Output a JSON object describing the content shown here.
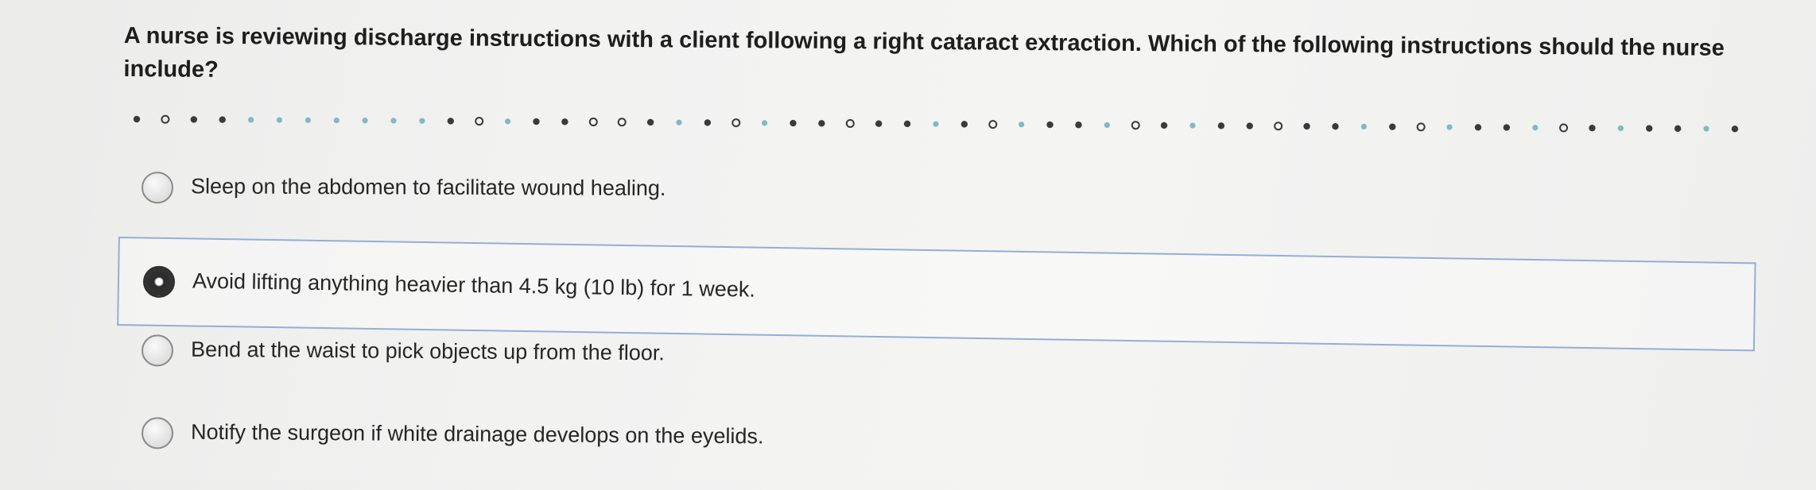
{
  "question": {
    "text": "A nurse is reviewing discharge instructions with a client following a right cataract extraction. Which of the following instructions should the nurse include?"
  },
  "options": [
    {
      "label": "Sleep on the abdomen to facilitate wound healing.",
      "selected": false
    },
    {
      "label": "Avoid lifting anything heavier than 4.5 kg (10 lb) for 1 week.",
      "selected": true
    },
    {
      "label": "Bend at the waist to pick objects up from the floor.",
      "selected": false
    },
    {
      "label": "Notify the surgeon if white drainage develops on the eyelids.",
      "selected": false
    }
  ],
  "colors": {
    "selected_border": "#93aed6",
    "dot_dark": "#3a3a3a",
    "dot_teal": "#7fb9c4"
  },
  "divider_dots": "ddddtttttddddddddddddtddtdttdtdtdttdtdtdttdtdtdttdtdtdttdtdtdttd"
}
